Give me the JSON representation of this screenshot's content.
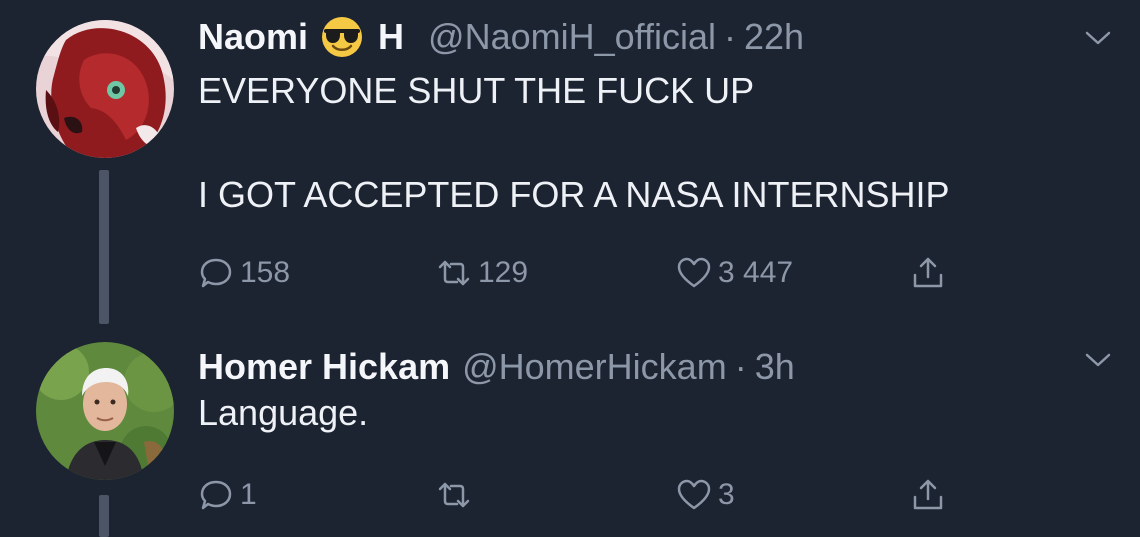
{
  "tweets": [
    {
      "display_name": "Naomi",
      "display_name_suffix": "H",
      "emoji": "sunglasses-emoji",
      "handle": "@NaomiH_official",
      "separator": "·",
      "timestamp": "22h",
      "text_lines": [
        "EVERYONE SHUT THE FUCK UP",
        "I GOT ACCEPTED FOR A NASA INTERNSHIP"
      ],
      "replies": "158",
      "retweets": "129",
      "likes": "3 447"
    },
    {
      "display_name": "Homer Hickam",
      "handle": "@HomerHickam",
      "separator": "·",
      "timestamp": "3h",
      "text_lines": [
        "Language."
      ],
      "replies": "1",
      "retweets": "",
      "likes": "3"
    }
  ],
  "icons": {
    "reply": "reply-icon",
    "retweet": "retweet-icon",
    "like": "heart-icon",
    "share": "share-icon",
    "more": "chevron-down-icon"
  },
  "colors": {
    "background": "#1c2331",
    "text": "#eef1f5",
    "secondary": "#8c97a8",
    "thread_line": "#4b5566"
  }
}
